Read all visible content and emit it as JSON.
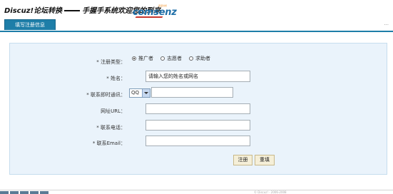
{
  "header": {
    "title_left": "Discuz!论坛转换",
    "title_right": "手握手系统欢迎您的到来",
    "logo_text": "comsenz",
    "logo_small": "康盛创想"
  },
  "tabs": {
    "active_label": "填写注册信息",
    "more": "..."
  },
  "form": {
    "type_label": "* 注册类型：",
    "type_options": [
      "推广者",
      "志愿者",
      "求助者"
    ],
    "type_selected": "推广者",
    "name_label": "* 姓名：",
    "name_value": "请输入您的姓名或网名",
    "im_label": "* 联系即时通讯：",
    "im_select": "QQ",
    "im_value": "",
    "url_label": "网址URL：",
    "url_value": "",
    "phone_label": "* 联系电话：",
    "phone_value": "",
    "email_label": "* 联系Email：",
    "email_value": "",
    "submit_label": "注册",
    "reset_label": "重填"
  },
  "footer": {
    "text": "© Discuz! · 2006-2008"
  },
  "colors": {
    "tab_blue": "#1e7ea8",
    "panel_bg": "#eaf3fb",
    "button_bg": "#f5efd8"
  }
}
